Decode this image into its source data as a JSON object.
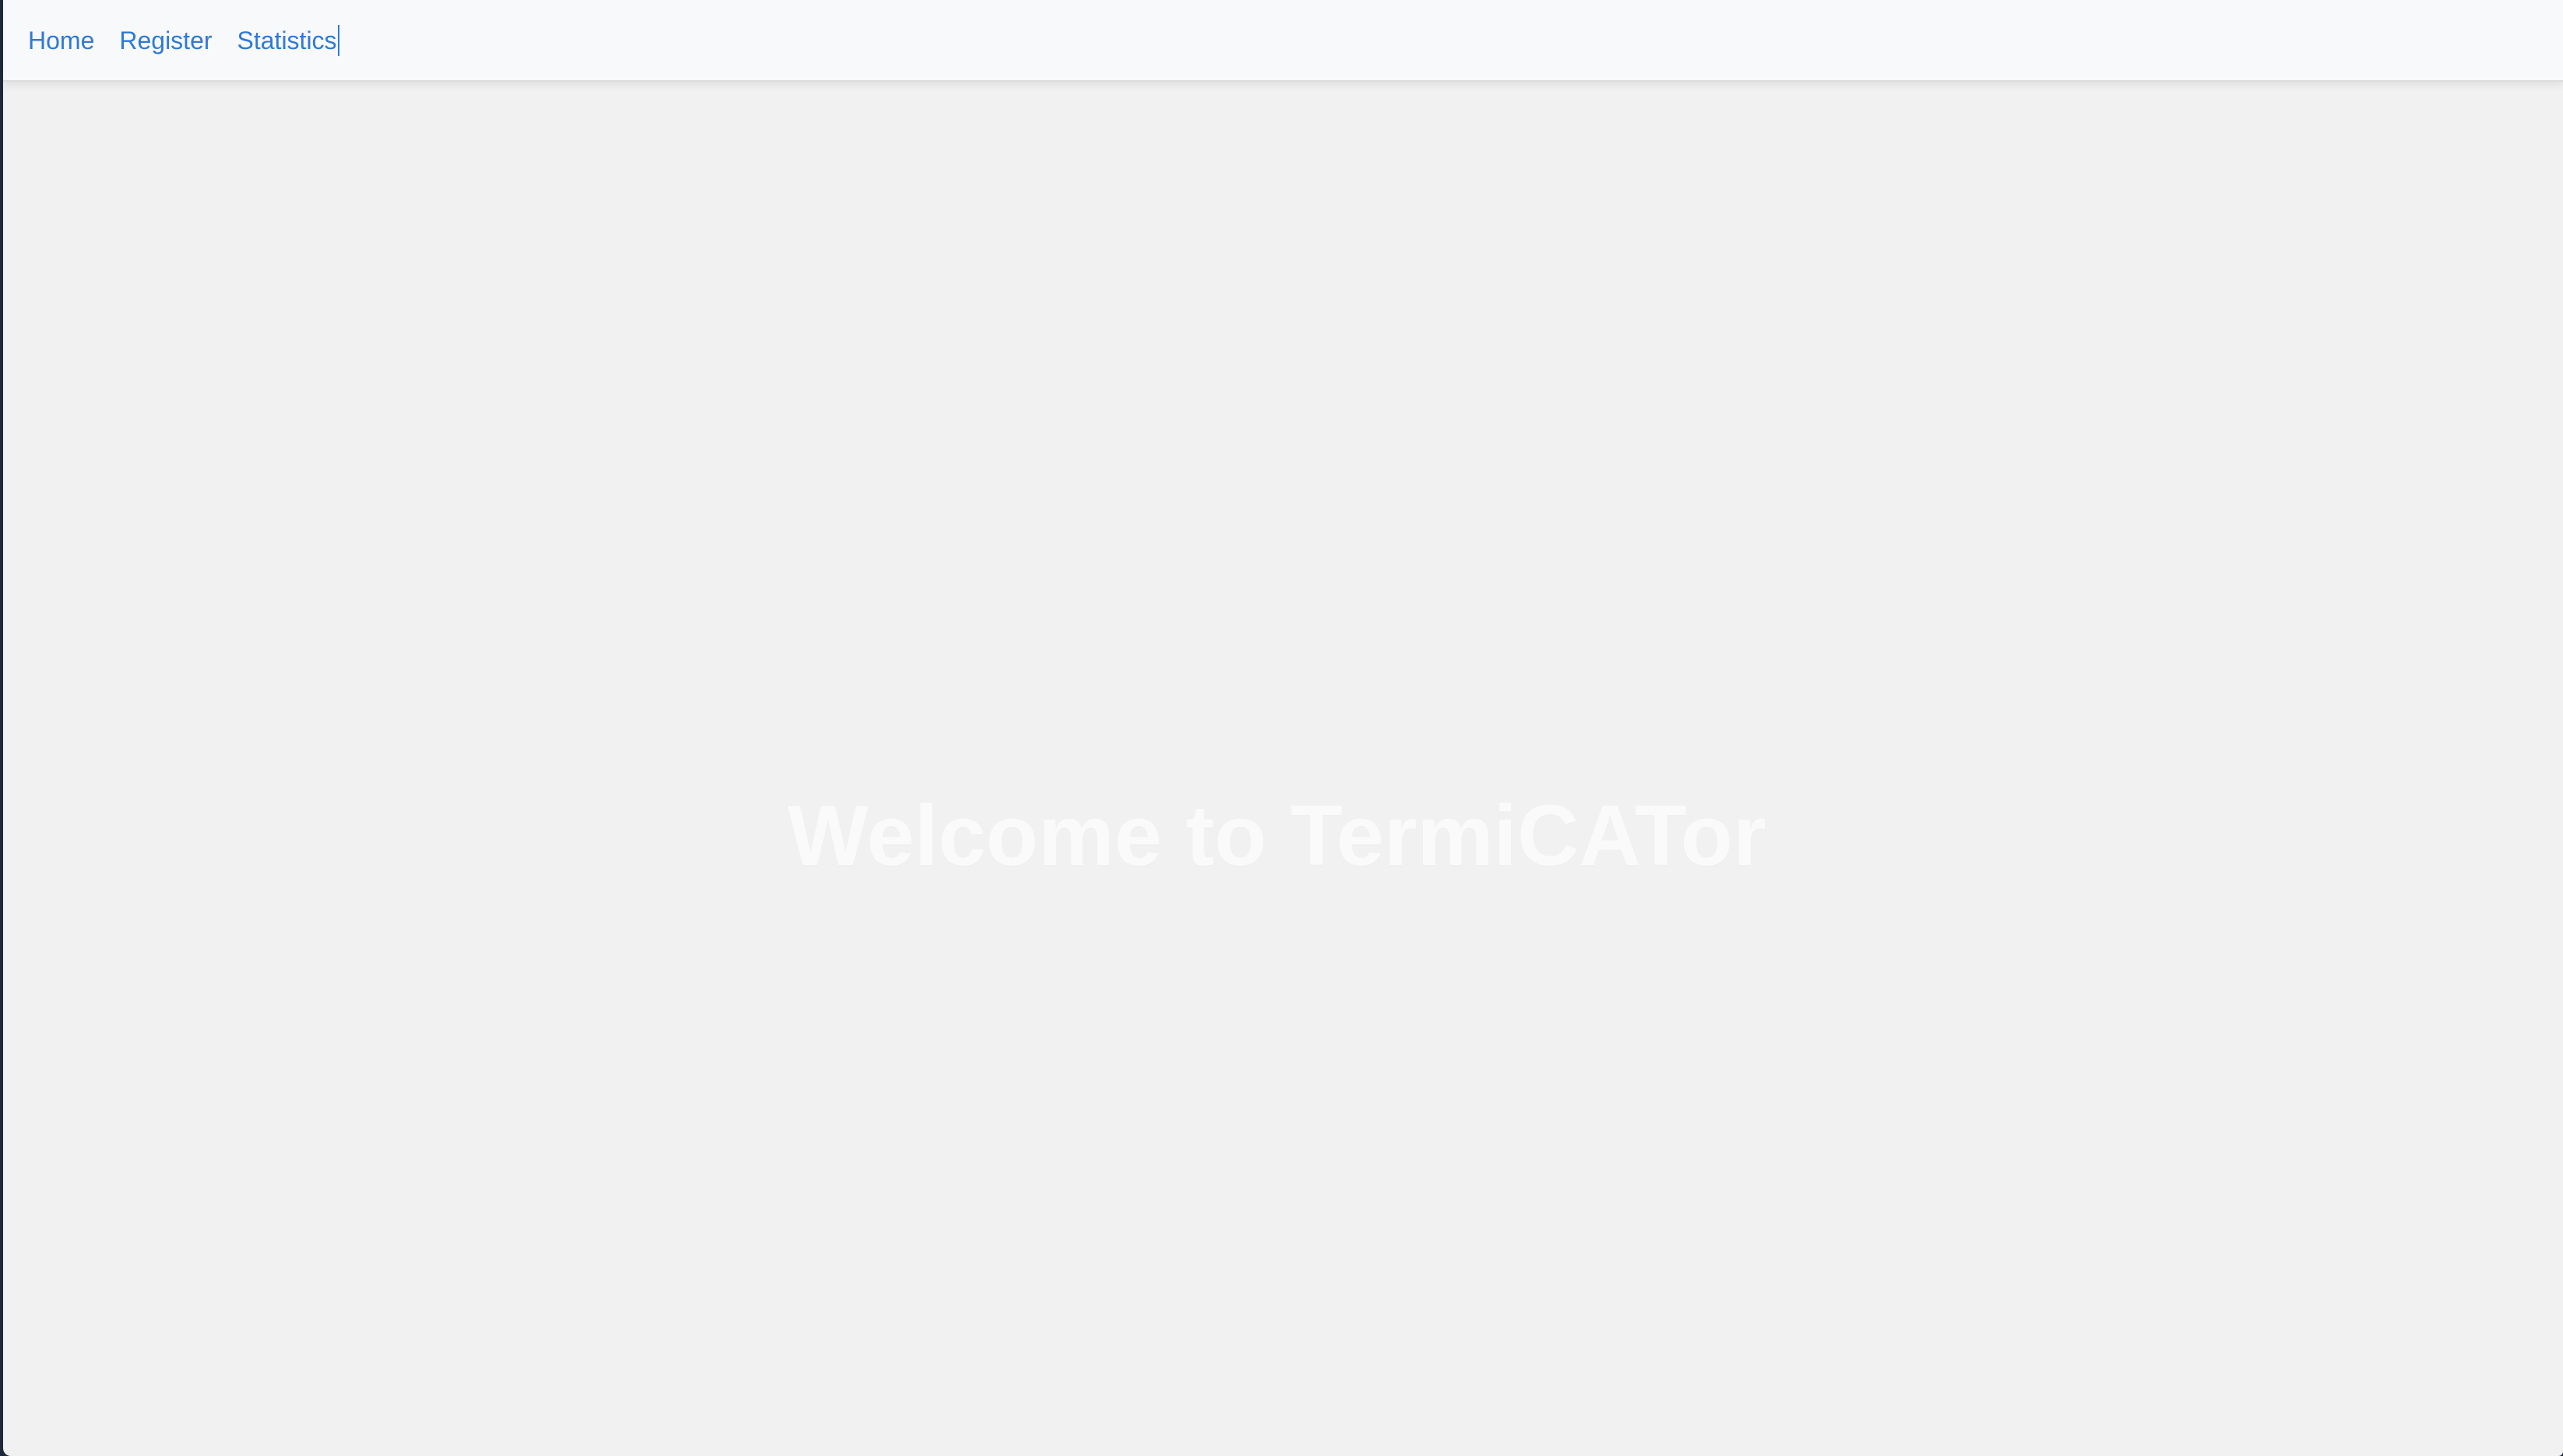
{
  "nav": {
    "items": [
      {
        "label": "Home"
      },
      {
        "label": "Register"
      },
      {
        "label": "Statistics"
      }
    ],
    "link_color": "#2f7ad4",
    "background": "#f8f9fa"
  },
  "hero": {
    "title": "Welcome to TermiCATor",
    "title_color": "#fafafa"
  },
  "page": {
    "background": "#f1f1f1"
  }
}
